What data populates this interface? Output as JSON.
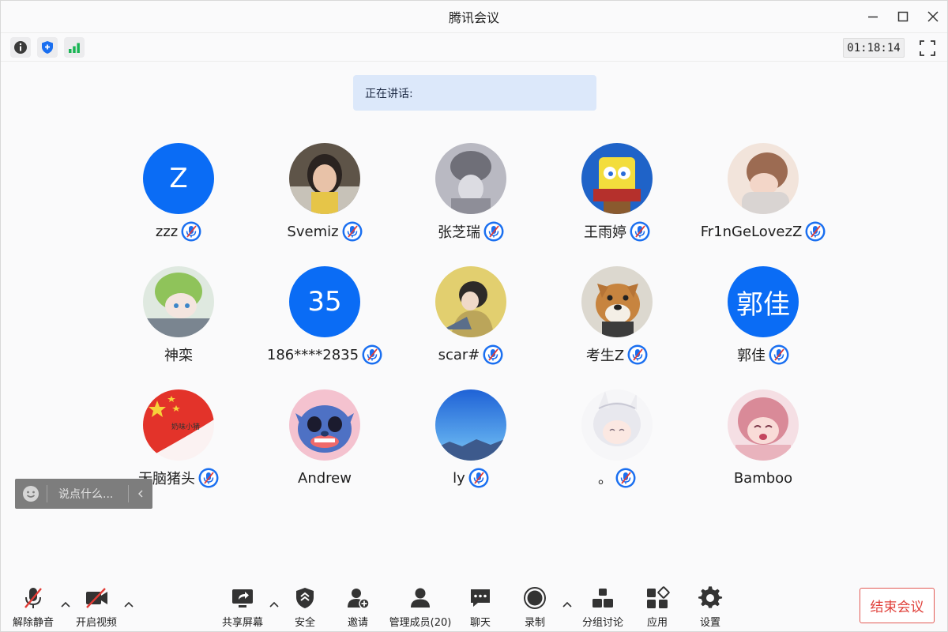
{
  "window": {
    "title": "腾讯会议"
  },
  "infobar": {
    "timer": "01:18:14"
  },
  "speaking": {
    "label": "正在讲话:"
  },
  "participants": [
    {
      "name": "zzz",
      "muted": true,
      "avatar": "initial",
      "initial": "Z",
      "color": "#0a6cf5"
    },
    {
      "name": "Svemiz",
      "muted": true,
      "avatar": "photo-girl",
      "color": "#6b5a48"
    },
    {
      "name": "张芝瑞",
      "muted": true,
      "avatar": "photo-gray",
      "color": "#8a8a94"
    },
    {
      "name": "王雨婷",
      "muted": true,
      "avatar": "photo-spongebob",
      "color": "#f0d530"
    },
    {
      "name": "Fr1nGeLovezZ",
      "muted": true,
      "avatar": "illustration-boy",
      "color": "#e9c9b8"
    },
    {
      "name": "神栾",
      "muted": false,
      "avatar": "anime-green",
      "color": "#9fc8a0"
    },
    {
      "name": "186****2835",
      "muted": true,
      "avatar": "initial",
      "initial": "35",
      "color": "#0a6cf5"
    },
    {
      "name": "scar#",
      "muted": true,
      "avatar": "illustration-sad",
      "color": "#c4a858"
    },
    {
      "name": "考生Z",
      "muted": true,
      "avatar": "photo-dog",
      "color": "#c98d4e"
    },
    {
      "name": "郭佳",
      "muted": true,
      "avatar": "initial",
      "initial": "郭佳",
      "color": "#0a6cf5"
    },
    {
      "name": "无脑猪头",
      "muted": true,
      "avatar": "flag",
      "color": "#e8302a"
    },
    {
      "name": "Andrew",
      "muted": false,
      "avatar": "stitch",
      "color": "#5878c8"
    },
    {
      "name": "ly",
      "muted": true,
      "avatar": "sky",
      "color": "#2e6fd6"
    },
    {
      "name": "。",
      "muted": true,
      "avatar": "anime-white",
      "color": "#e6e6ea"
    },
    {
      "name": "Bamboo",
      "muted": false,
      "avatar": "anime-pink",
      "color": "#e8a0ac"
    }
  ],
  "chat": {
    "placeholder": "说点什么..."
  },
  "toolbar": {
    "unmute": "解除静音",
    "video": "开启视频",
    "share": "共享屏幕",
    "security": "安全",
    "invite": "邀请",
    "members": "管理成员(20)",
    "chat": "聊天",
    "record": "录制",
    "breakout": "分组讨论",
    "apps": "应用",
    "settings": "设置",
    "end": "结束会议"
  },
  "colors": {
    "accent": "#0a6cf5",
    "danger": "#e0403a",
    "speaking_bg": "#dce8fa"
  }
}
